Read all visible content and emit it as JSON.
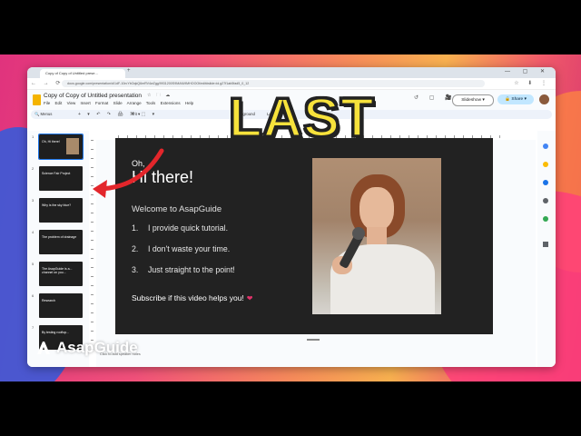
{
  "browser": {
    "tab_title": "Copy of Copy of Untitled prese...",
    "tab_plus": "+",
    "window_controls": "— ▢ ✕",
    "nav_icons": "← → ⟳",
    "url": "docs.google.com/presentation/d/1dF-10rcYbOqkQ6mRV4wZgg/9931200S9MAfU9MHOOOt/edit#slide=id.g27f1ab5fad5_0_12",
    "addr_icons": "☆ ⬇ ⋮"
  },
  "doc": {
    "title": "Copy of Copy of Untitled presentation",
    "title_icons": "☆ 🗀 ☁",
    "menu": [
      "File",
      "Edit",
      "View",
      "Insert",
      "Format",
      "Slide",
      "Arrange",
      "Tools",
      "Extensions",
      "Help"
    ],
    "header_icons": "↺ ▢ 🎥",
    "slideshow_label": "Slideshow  ▾",
    "share_label": "🔒 Share  ▾"
  },
  "toolbar": {
    "menus_label": "🔍 Menus",
    "icons": "+ ▾ ↶ ↷ 🖨 ⌘ ⬚ ▾",
    "zoom": "Fit  ▾",
    "background": "Background",
    "layout": "Layout  ▾"
  },
  "filmstrip": {
    "slides": [
      {
        "num": "1",
        "text": "Oh, Hi there!"
      },
      {
        "num": "2",
        "text": "Science Fair Project"
      },
      {
        "num": "3",
        "text": "Why is the sky blue?"
      },
      {
        "num": "4",
        "text": "The problem of drainage"
      },
      {
        "num": "5",
        "text": "The AsapGuide is a... channel on you..."
      },
      {
        "num": "6",
        "text": "Research"
      },
      {
        "num": "7",
        "text": "By testing rooftop..."
      }
    ]
  },
  "slide": {
    "greeting": "Oh,",
    "headline": "Hi there!",
    "welcome": "Welcome to AsapGuide",
    "list": [
      {
        "n": "1.",
        "text": "I provide quick tutorial."
      },
      {
        "n": "2.",
        "text": "I don't waste your time."
      },
      {
        "n": "3.",
        "text": "Just straight to the point!"
      }
    ],
    "subscribe": "Subscribe if this video helps you!",
    "heart": "❤"
  },
  "overlay": {
    "big_text": "LAST",
    "brand": "AsapGuide",
    "speaker_notes": "Click to add speaker notes"
  },
  "colors": {
    "accent": "#1a73e8",
    "share_bg": "#c2e7ff",
    "overlay_text": "#f7e23b",
    "arrow": "#e3262b",
    "slide_bg": "#222222"
  }
}
